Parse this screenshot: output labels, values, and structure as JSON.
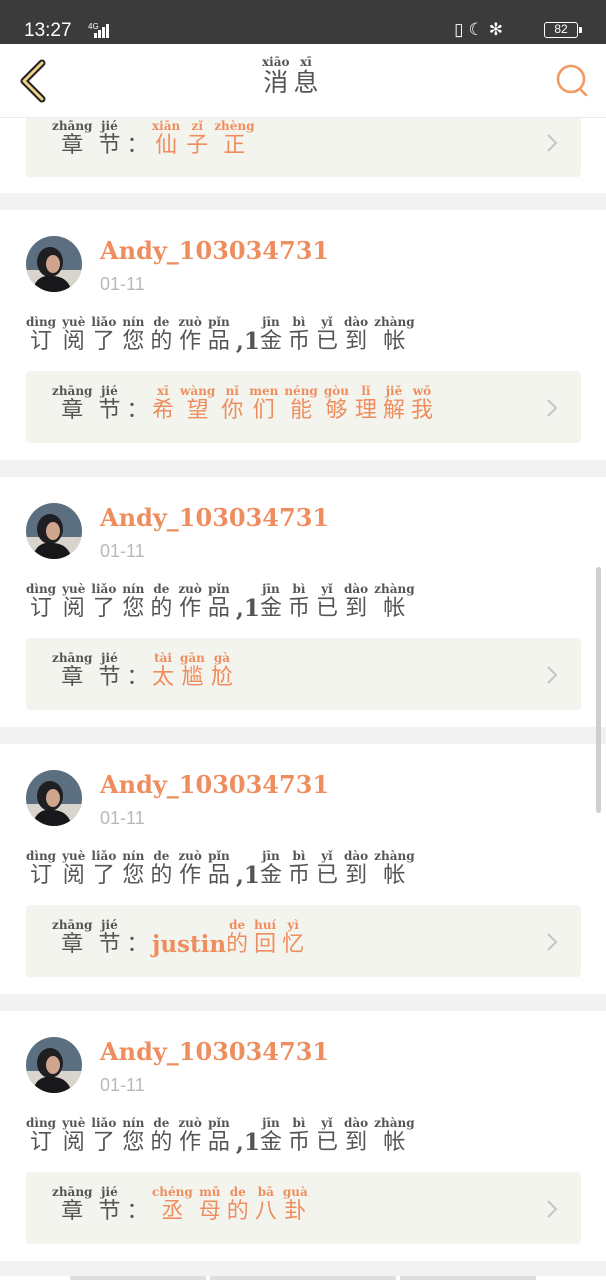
{
  "status_bar": {
    "time": "13:27",
    "network": "4G",
    "battery": "82"
  },
  "header": {
    "title": [
      {
        "hz": "消",
        "py": "xiāo"
      },
      {
        "hz": "息",
        "py": "xī"
      }
    ]
  },
  "colors": {
    "accent": "#ee8e5f",
    "text": "#555555",
    "muted": "#b9b9b9",
    "chapter_bg": "#f4f4ee",
    "status_bar": "#3b3b3b"
  },
  "icons": {
    "back": "chevron-left-icon",
    "search": "search-icon",
    "row": "chevron-right-icon",
    "avatar": "user-avatar"
  },
  "partial_top": {
    "chapter_label": [
      {
        "hz": "章",
        "py": "zhāng"
      },
      {
        "hz": "节",
        "py": "jié"
      },
      {
        "hz": "："
      }
    ],
    "chapter_name": [
      {
        "hz": "仙",
        "py": "xiān"
      },
      {
        "hz": "子",
        "py": "zǐ"
      },
      {
        "hz": "正",
        "py": "zhèng"
      }
    ]
  },
  "messages": [
    {
      "username": "Andy_103034731",
      "date": "01-11",
      "text": [
        {
          "hz": "订",
          "py": "dìng"
        },
        {
          "hz": "阅",
          "py": "yuè"
        },
        {
          "hz": "了",
          "py": "liǎo"
        },
        {
          "hz": "您",
          "py": "nín"
        },
        {
          "hz": "的",
          "py": "de"
        },
        {
          "hz": "作",
          "py": "zuò"
        },
        {
          "hz": "品",
          "py": "pǐn"
        },
        {
          "latin": ",1"
        },
        {
          "hz": "金",
          "py": "jīn"
        },
        {
          "hz": "币",
          "py": "bì"
        },
        {
          "hz": "已",
          "py": "yǐ"
        },
        {
          "hz": "到",
          "py": "dào"
        },
        {
          "hz": "帐",
          "py": "zhàng"
        }
      ],
      "chapter_label": [
        {
          "hz": "章",
          "py": "zhāng"
        },
        {
          "hz": "节",
          "py": "jié"
        },
        {
          "hz": "："
        }
      ],
      "chapter_name": [
        {
          "hz": "希",
          "py": "xī"
        },
        {
          "hz": "望",
          "py": "wàng"
        },
        {
          "hz": "你",
          "py": "nǐ"
        },
        {
          "hz": "们",
          "py": "men"
        },
        {
          "hz": "能",
          "py": "néng"
        },
        {
          "hz": "够",
          "py": "gòu"
        },
        {
          "hz": "理",
          "py": "lǐ"
        },
        {
          "hz": "解",
          "py": "jiě"
        },
        {
          "hz": "我",
          "py": "wǒ"
        }
      ]
    },
    {
      "username": "Andy_103034731",
      "date": "01-11",
      "text": [
        {
          "hz": "订",
          "py": "dìng"
        },
        {
          "hz": "阅",
          "py": "yuè"
        },
        {
          "hz": "了",
          "py": "liǎo"
        },
        {
          "hz": "您",
          "py": "nín"
        },
        {
          "hz": "的",
          "py": "de"
        },
        {
          "hz": "作",
          "py": "zuò"
        },
        {
          "hz": "品",
          "py": "pǐn"
        },
        {
          "latin": ",1"
        },
        {
          "hz": "金",
          "py": "jīn"
        },
        {
          "hz": "币",
          "py": "bì"
        },
        {
          "hz": "已",
          "py": "yǐ"
        },
        {
          "hz": "到",
          "py": "dào"
        },
        {
          "hz": "帐",
          "py": "zhàng"
        }
      ],
      "chapter_label": [
        {
          "hz": "章",
          "py": "zhāng"
        },
        {
          "hz": "节",
          "py": "jié"
        },
        {
          "hz": "："
        }
      ],
      "chapter_name": [
        {
          "hz": "太",
          "py": "tài"
        },
        {
          "hz": "尴",
          "py": "gān"
        },
        {
          "hz": "尬",
          "py": "gà"
        }
      ]
    },
    {
      "username": "Andy_103034731",
      "date": "01-11",
      "text": [
        {
          "hz": "订",
          "py": "dìng"
        },
        {
          "hz": "阅",
          "py": "yuè"
        },
        {
          "hz": "了",
          "py": "liǎo"
        },
        {
          "hz": "您",
          "py": "nín"
        },
        {
          "hz": "的",
          "py": "de"
        },
        {
          "hz": "作",
          "py": "zuò"
        },
        {
          "hz": "品",
          "py": "pǐn"
        },
        {
          "latin": ",1"
        },
        {
          "hz": "金",
          "py": "jīn"
        },
        {
          "hz": "币",
          "py": "bì"
        },
        {
          "hz": "已",
          "py": "yǐ"
        },
        {
          "hz": "到",
          "py": "dào"
        },
        {
          "hz": "帐",
          "py": "zhàng"
        }
      ],
      "chapter_label": [
        {
          "hz": "章",
          "py": "zhāng"
        },
        {
          "hz": "节",
          "py": "jié"
        },
        {
          "hz": "："
        }
      ],
      "chapter_name": [
        {
          "latin": "justin"
        },
        {
          "hz": "的",
          "py": "de"
        },
        {
          "hz": "回",
          "py": "huí"
        },
        {
          "hz": "忆",
          "py": "yì"
        }
      ]
    },
    {
      "username": "Andy_103034731",
      "date": "01-11",
      "text": [
        {
          "hz": "订",
          "py": "dìng"
        },
        {
          "hz": "阅",
          "py": "yuè"
        },
        {
          "hz": "了",
          "py": "liǎo"
        },
        {
          "hz": "您",
          "py": "nín"
        },
        {
          "hz": "的",
          "py": "de"
        },
        {
          "hz": "作",
          "py": "zuò"
        },
        {
          "hz": "品",
          "py": "pǐn"
        },
        {
          "latin": ",1"
        },
        {
          "hz": "金",
          "py": "jīn"
        },
        {
          "hz": "币",
          "py": "bì"
        },
        {
          "hz": "已",
          "py": "yǐ"
        },
        {
          "hz": "到",
          "py": "dào"
        },
        {
          "hz": "帐",
          "py": "zhàng"
        }
      ],
      "chapter_label": [
        {
          "hz": "章",
          "py": "zhāng"
        },
        {
          "hz": "节",
          "py": "jié"
        },
        {
          "hz": "："
        }
      ],
      "chapter_name": [
        {
          "hz": "丞",
          "py": "chéng"
        },
        {
          "hz": "母",
          "py": "mǔ"
        },
        {
          "hz": "的",
          "py": "de"
        },
        {
          "hz": "八",
          "py": "bā"
        },
        {
          "hz": "卦",
          "py": "guà"
        }
      ]
    }
  ]
}
